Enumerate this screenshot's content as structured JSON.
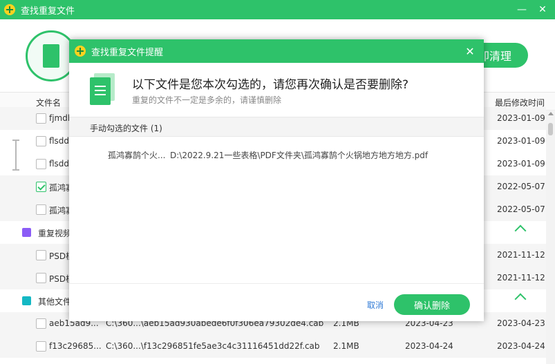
{
  "window": {
    "title": "查找重复文件",
    "minimize": "—",
    "close": "✕"
  },
  "header": {
    "action_button": "即清理"
  },
  "columns": {
    "name": "文件名",
    "modified": "最后修改时间"
  },
  "rows": [
    {
      "name": "fjmdk",
      "date": "2023-01-09",
      "checked": false
    },
    {
      "name": "flsdd",
      "date": "2023-01-09",
      "checked": false
    },
    {
      "name": "flsdd",
      "date": "2023-01-09",
      "checked": false
    },
    {
      "name": "孤鸿寡",
      "date": "2022-05-07",
      "checked": true
    },
    {
      "name": "孤鸿寡",
      "date": "2022-05-07",
      "checked": false
    },
    {
      "name": "PSD模",
      "date": "2021-11-12",
      "checked": false
    },
    {
      "name": "PSD模",
      "date": "2021-11-12",
      "checked": false
    },
    {
      "name": "aeb15ad9...",
      "path": "C:\\360...\\aeb15ad930abede6f0f306ea79302de4.cab",
      "size": "2.1MB",
      "mdate": "2023-04-23",
      "date": "2023-04-23",
      "checked": false
    },
    {
      "name": "f13c29685...",
      "path": "C:\\360...\\f13c296851fe5ae3c4c31116451dd22f.cab",
      "size": "2.1MB",
      "mdate": "2023-04-24",
      "date": "2023-04-24",
      "checked": false
    }
  ],
  "groups": {
    "video": {
      "label": "重复视频",
      "color": "#8b5cf6"
    },
    "other": {
      "label": "其他文件",
      "color": "#14b8c4"
    }
  },
  "dialog": {
    "title": "查找重复文件提醒",
    "close": "✕",
    "heading": "以下文件是您本次勾选的，请您再次确认是否要删除?",
    "subtext": "重复的文件不一定是多余的，请谨慎删除",
    "section_label": "手动勾选的文件 (1)",
    "file": {
      "name": "孤鸿寡鹄个火...",
      "path": "D:\\2022.9.21一些表格\\PDF文件夹\\孤鸿寡鹄个火锅地方地方地方.pdf"
    },
    "cancel": "取消",
    "confirm": "确认删除"
  },
  "colors": {
    "accent": "#2ec26a",
    "link": "#2f7ad6"
  }
}
